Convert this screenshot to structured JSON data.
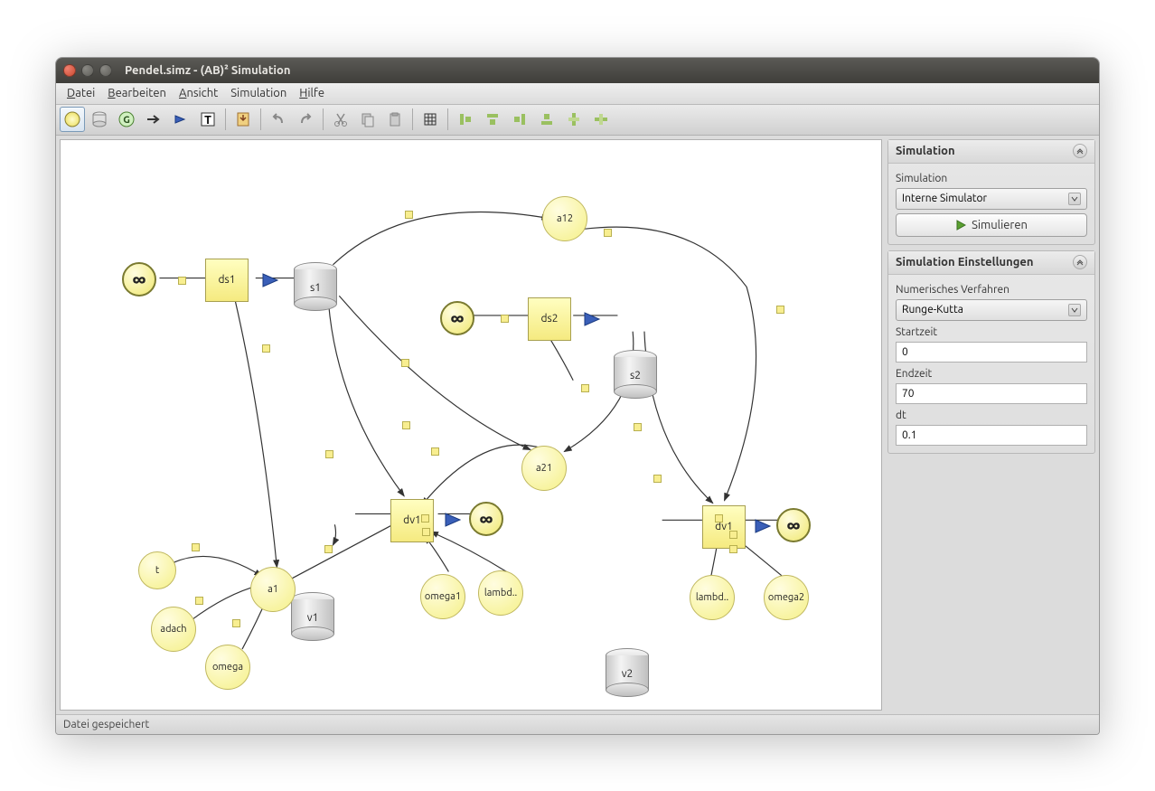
{
  "window": {
    "title": "Pendel.simz - (AB)² Simulation"
  },
  "menu": {
    "datei": "Datei",
    "bearbeiten": "Bearbeiten",
    "ansicht": "Ansicht",
    "simulation": "Simulation",
    "hilfe": "Hilfe"
  },
  "sidebar": {
    "sim_panel": {
      "title": "Simulation",
      "sim_label": "Simulation",
      "sim_combo": "Interne Simulator",
      "run_btn": "Simulieren"
    },
    "settings_panel": {
      "title": "Simulation Einstellungen",
      "method_label": "Numerisches Verfahren",
      "method_combo": "Runge-Kutta",
      "start_label": "Startzeit",
      "start_value": "0",
      "end_label": "Endzeit",
      "end_value": "70",
      "dt_label": "dt",
      "dt_value": "0.1"
    }
  },
  "statusbar": {
    "text": "Datei gespeichert"
  },
  "nodes": {
    "ds1": "ds1",
    "s1": "s1",
    "ds2": "ds2",
    "s2": "s2",
    "v1": "v1",
    "dv1": "dv1",
    "v2": "v2",
    "dv2": "dv1",
    "a12": "a12",
    "a21": "a21",
    "a1": "a1",
    "t": "t",
    "adach": "adach",
    "omega": "omega",
    "omega1": "omega1",
    "omega2": "omega2",
    "lambd1": "lambd..",
    "lambd2": "lambd..",
    "inf": "∞"
  }
}
